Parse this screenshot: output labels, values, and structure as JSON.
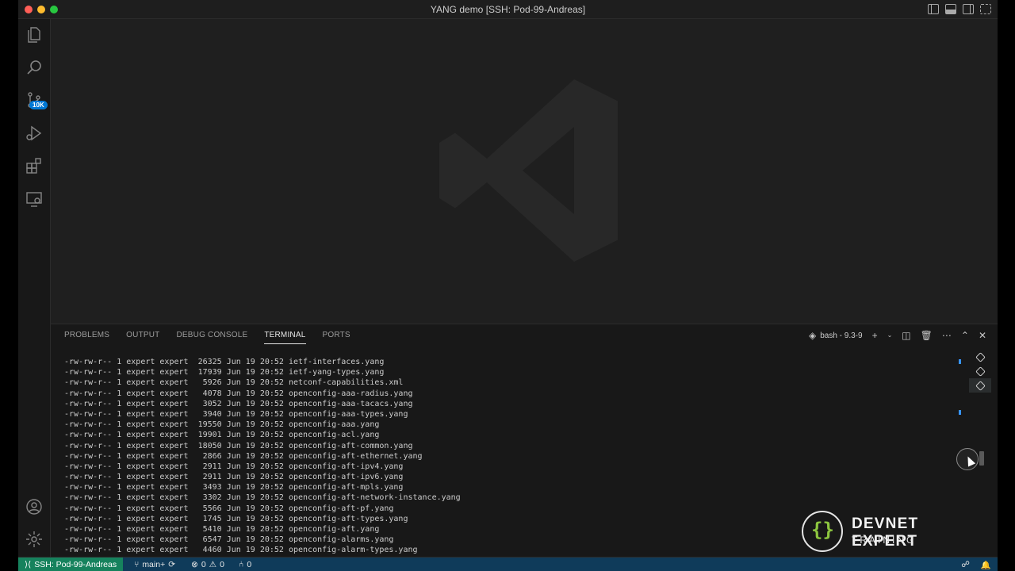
{
  "window": {
    "title": "YANG demo [SSH: Pod-99-Andreas]"
  },
  "activity_bar": {
    "items": [
      {
        "icon": "files-icon"
      },
      {
        "icon": "search-icon"
      },
      {
        "icon": "source-control-icon",
        "badge": "10K"
      },
      {
        "icon": "run-debug-icon"
      },
      {
        "icon": "extensions-icon"
      },
      {
        "icon": "remote-explorer-icon"
      }
    ],
    "bottom": [
      {
        "icon": "account-icon"
      },
      {
        "icon": "settings-gear-icon"
      }
    ]
  },
  "panel": {
    "tabs": [
      {
        "label": "PROBLEMS",
        "active": false
      },
      {
        "label": "OUTPUT",
        "active": false
      },
      {
        "label": "DEBUG CONSOLE",
        "active": false
      },
      {
        "label": "TERMINAL",
        "active": true
      },
      {
        "label": "PORTS",
        "active": false
      }
    ],
    "shell_label": "bash - 9.3-9"
  },
  "terminal": {
    "lines": [
      "-rw-rw-r-- 1 expert expert  26325 Jun 19 20:52 ietf-interfaces.yang",
      "-rw-rw-r-- 1 expert expert  17939 Jun 19 20:52 ietf-yang-types.yang",
      "-rw-rw-r-- 1 expert expert   5926 Jun 19 20:52 netconf-capabilities.xml",
      "-rw-rw-r-- 1 expert expert   4078 Jun 19 20:52 openconfig-aaa-radius.yang",
      "-rw-rw-r-- 1 expert expert   3052 Jun 19 20:52 openconfig-aaa-tacacs.yang",
      "-rw-rw-r-- 1 expert expert   3940 Jun 19 20:52 openconfig-aaa-types.yang",
      "-rw-rw-r-- 1 expert expert  19550 Jun 19 20:52 openconfig-aaa.yang",
      "-rw-rw-r-- 1 expert expert  19901 Jun 19 20:52 openconfig-acl.yang",
      "-rw-rw-r-- 1 expert expert  18050 Jun 19 20:52 openconfig-aft-common.yang",
      "-rw-rw-r-- 1 expert expert   2866 Jun 19 20:52 openconfig-aft-ethernet.yang",
      "-rw-rw-r-- 1 expert expert   2911 Jun 19 20:52 openconfig-aft-ipv4.yang",
      "-rw-rw-r-- 1 expert expert   2911 Jun 19 20:52 openconfig-aft-ipv6.yang",
      "-rw-rw-r-- 1 expert expert   3493 Jun 19 20:52 openconfig-aft-mpls.yang",
      "-rw-rw-r-- 1 expert expert   3302 Jun 19 20:52 openconfig-aft-network-instance.yang",
      "-rw-rw-r-- 1 expert expert   5566 Jun 19 20:52 openconfig-aft-pf.yang",
      "-rw-rw-r-- 1 expert expert   1745 Jun 19 20:52 openconfig-aft-types.yang",
      "-rw-rw-r-- 1 expert expert   5410 Jun 19 20:52 openconfig-aft.yang",
      "-rw-rw-r-- 1 expert expert   6547 Jun 19 20:52 openconfig-alarms.yang",
      "-rw-rw-r-- 1 expert expert   4460 Jun 19 20:52 openconfig-alarm-types.yang"
    ]
  },
  "logo": {
    "line1": "DEVNET EXPERT",
    "line2": "TRAINING",
    "brace": "{}"
  },
  "status_bar": {
    "remote": "SSH: Pod-99-Andreas",
    "branch": "main+",
    "errors": "0",
    "warnings": "0",
    "ports": "0"
  },
  "colors": {
    "accent": "#0078d4",
    "remote_bg": "#16825d",
    "logo_brace": "#8dc63f"
  }
}
